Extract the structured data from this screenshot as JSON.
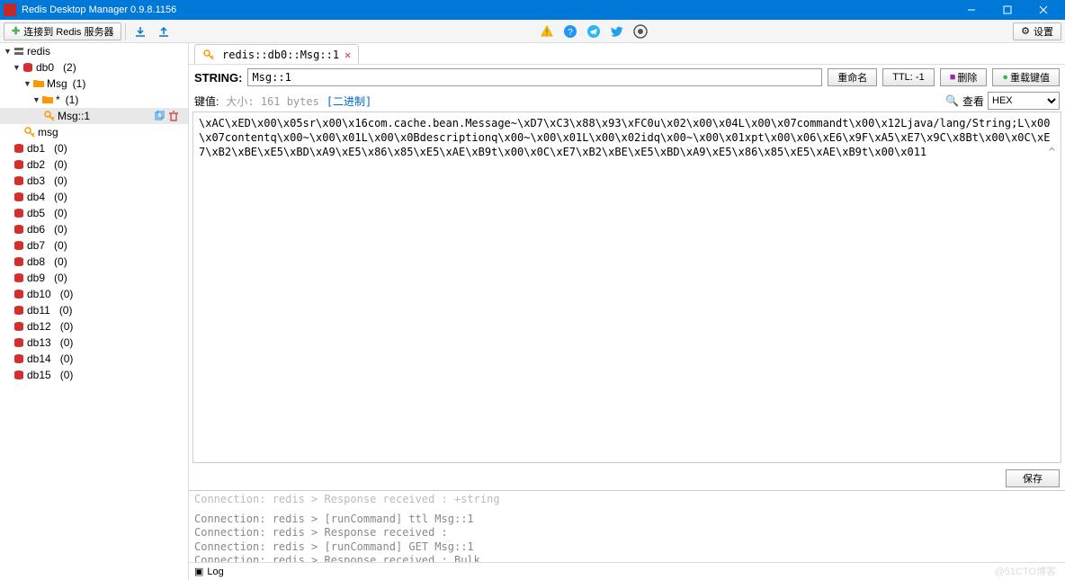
{
  "window": {
    "title": "Redis Desktop Manager 0.9.8.1156"
  },
  "toolbar": {
    "connect_btn": "连接到 Redis 服务器",
    "settings_btn": "设置"
  },
  "sidebar": {
    "connection": "redis",
    "db0": {
      "name": "db0",
      "count": "(2)"
    },
    "msg_folder": {
      "name": "Msg",
      "count": "(1)"
    },
    "star_folder": {
      "name": "*",
      "count": "(1)"
    },
    "key1": "Msg::1",
    "key2": "msg",
    "dbs": [
      {
        "name": "db1",
        "count": "(0)"
      },
      {
        "name": "db2",
        "count": "(0)"
      },
      {
        "name": "db3",
        "count": "(0)"
      },
      {
        "name": "db4",
        "count": "(0)"
      },
      {
        "name": "db5",
        "count": "(0)"
      },
      {
        "name": "db6",
        "count": "(0)"
      },
      {
        "name": "db7",
        "count": "(0)"
      },
      {
        "name": "db8",
        "count": "(0)"
      },
      {
        "name": "db9",
        "count": "(0)"
      },
      {
        "name": "db10",
        "count": "(0)"
      },
      {
        "name": "db11",
        "count": "(0)"
      },
      {
        "name": "db12",
        "count": "(0)"
      },
      {
        "name": "db13",
        "count": "(0)"
      },
      {
        "name": "db14",
        "count": "(0)"
      },
      {
        "name": "db15",
        "count": "(0)"
      }
    ]
  },
  "tab": {
    "title": "redis::db0::Msg::1"
  },
  "key_view": {
    "type_label": "STRING:",
    "key_name": "Msg::1",
    "rename_btn": "重命名",
    "ttl_btn": "TTL: -1",
    "delete_btn": "删除",
    "reload_btn": "重载键值",
    "value_label": "键值:",
    "size_text": "大小: 161 bytes",
    "binary_link": "[二进制]",
    "view_btn": "查看",
    "view_mode": "HEX",
    "value_text": "\\xAC\\xED\\x00\\x05sr\\x00\\x16com.cache.bean.Message~\\xD7\\xC3\\x88\\x93\\xFC0u\\x02\\x00\\x04L\\x00\\x07commandt\\x00\\x12Ljava/lang/String;L\\x00\\x07contentq\\x00~\\x00\\x01L\\x00\\x0Bdescriptionq\\x00~\\x00\\x01L\\x00\\x02idq\\x00~\\x00\\x01xpt\\x00\\x06\\xE6\\x9F\\xA5\\xE7\\x9C\\x8Bt\\x00\\x0C\\xE7\\xB2\\xBE\\xE5\\xBD\\xA9\\xE5\\x86\\x85\\xE5\\xAE\\xB9t\\x00\\x0C\\xE7\\xB2\\xBE\\xE5\\xBD\\xA9\\xE5\\x86\\x85\\xE5\\xAE\\xB9t\\x00\\x011",
    "save_btn": "保存"
  },
  "log": {
    "line0": "Connection: redis > Response received : +string",
    "line1": "Connection: redis > [runCommand] ttl Msg::1",
    "line2": "Connection: redis > Response received :",
    "line3": "Connection: redis > [runCommand] GET Msg::1",
    "line4": "Connection: redis > Response received : Bulk",
    "footer_label": "Log"
  },
  "watermark": "@51CTO博客"
}
